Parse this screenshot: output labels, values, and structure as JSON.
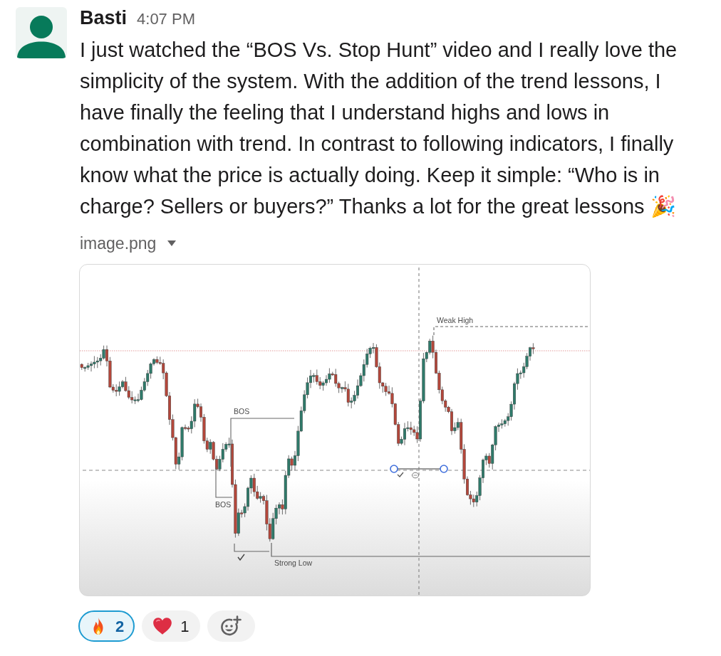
{
  "message": {
    "author": "Basti",
    "time": "4:07 PM",
    "text": "I just watched the “BOS Vs. Stop Hunt” video and I really love the simplicity of the system. With the addition of the trend lessons, I have finally the feeling that I understand highs and lows in combination with trend. In contrast to following indicators, I finally know what the price is actually doing. Keep it simple: “Who is in charge? Sellers or buyers?” Thanks a lot for the great lessons 🎉"
  },
  "attachment": {
    "filename": "image.png",
    "chart_labels": {
      "weak_high": "Weak High",
      "upper_bos": "BOS",
      "lower_bos": "BOS",
      "strong_low": "Strong Low"
    }
  },
  "reactions": [
    {
      "kind": "fire",
      "count": "2",
      "selected": true
    },
    {
      "kind": "heart",
      "count": "1",
      "selected": false
    }
  ]
}
